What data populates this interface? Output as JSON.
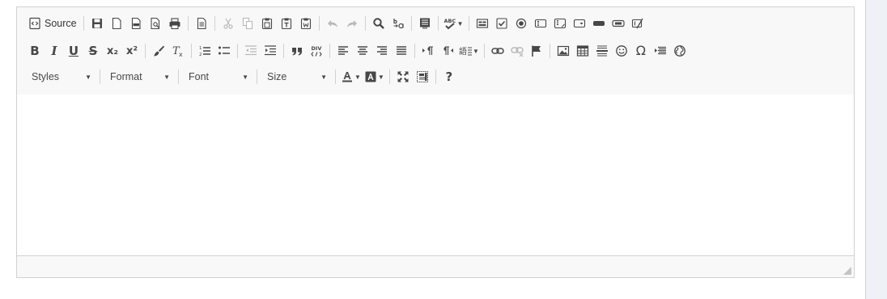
{
  "editor": {
    "toolbar": {
      "source_label": "Source",
      "styles_label": "Styles",
      "format_label": "Format",
      "font_label": "Font",
      "size_label": "Size",
      "help_label": "?",
      "subscript_label": "x₂",
      "superscript_label": "x²",
      "special_char_label": "Ω"
    },
    "content": "",
    "status": ""
  }
}
